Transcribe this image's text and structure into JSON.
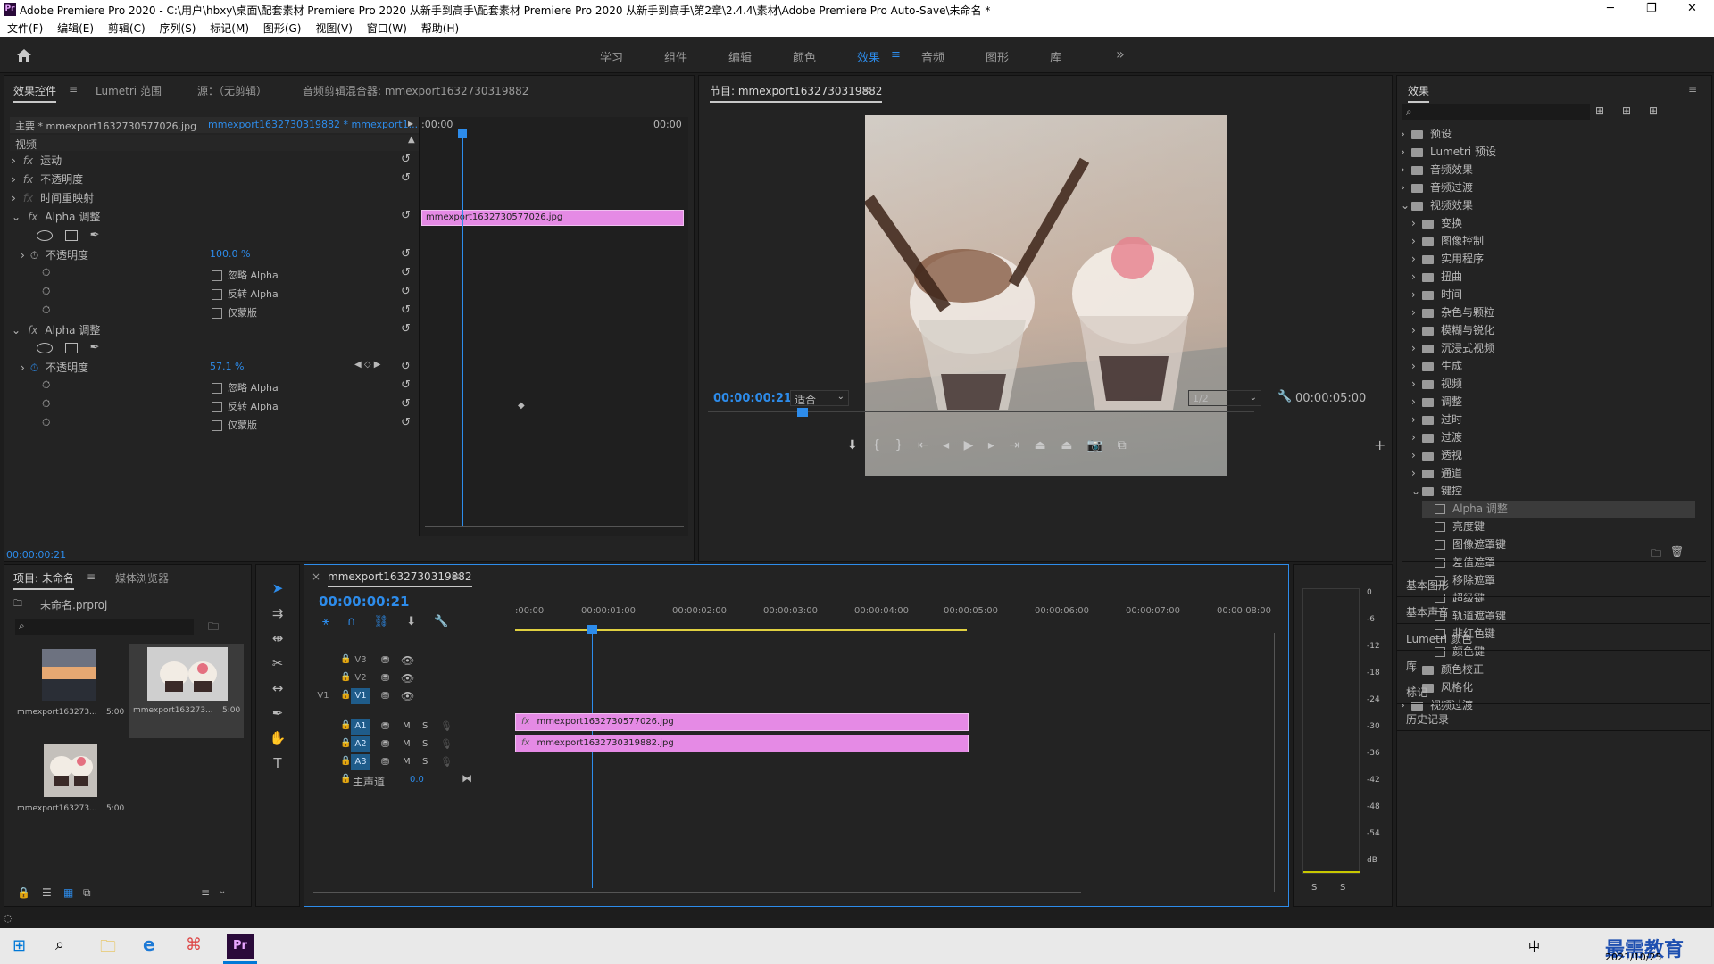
{
  "window": {
    "title": "Adobe Premiere Pro 2020 - C:\\用户\\hbxy\\桌面\\配套素材 Premiere Pro 2020 从新手到高手\\配套素材 Premiere Pro 2020 从新手到高手\\第2章\\2.4.4\\素材\\Adobe Premiere Pro Auto-Save\\未命名 *",
    "minimize": "─",
    "maximize": "❐",
    "close": "✕",
    "logo": "Pr"
  },
  "menu": [
    "文件(F)",
    "编辑(E)",
    "剪辑(C)",
    "序列(S)",
    "标记(M)",
    "图形(G)",
    "视图(V)",
    "窗口(W)",
    "帮助(H)"
  ],
  "workspaces": {
    "items": [
      "学习",
      "组件",
      "编辑",
      "颜色",
      "效果",
      "音频",
      "图形",
      "库"
    ],
    "active": "效果",
    "more": "»",
    "menu_icon": "≡"
  },
  "effect_controls": {
    "tabs": [
      "效果控件",
      "Lumetri 范围",
      "源：（无剪辑）",
      "音频剪辑混合器: mmexport1632730319882"
    ],
    "master": "主要 * mmexport1632730577026.jpg",
    "clip": "mmexport1632730319882 * mmexport1...",
    "section": "视频",
    "ruler_start": ":00:00",
    "ruler_end": "00:00",
    "clip_label": "mmexport1632730577026.jpg",
    "rows": [
      {
        "label": "运动",
        "fx": true
      },
      {
        "label": "不透明度",
        "fx": true
      },
      {
        "label": "时间重映射",
        "fx": true,
        "dim": true
      }
    ],
    "alpha1": {
      "title": "Alpha 调整",
      "opacity_label": "不透明度",
      "opacity": "100.0 %",
      "ignore": "忽略 Alpha",
      "invert": "反转 Alpha",
      "mask": "仅蒙版"
    },
    "alpha2": {
      "title": "Alpha 调整",
      "opacity_label": "不透明度",
      "opacity": "57.1 %",
      "ignore": "忽略 Alpha",
      "invert": "反转 Alpha",
      "mask": "仅蒙版"
    },
    "timecode": "00:00:00:21"
  },
  "program": {
    "title": "节目: mmexport1632730319882",
    "timecode": "00:00:00:21",
    "fit": "适合",
    "quality": "1/2",
    "duration": "00:00:05:00"
  },
  "effects_panel": {
    "title": "效果",
    "items": [
      {
        "label": "预设",
        "level": 0,
        "open": false
      },
      {
        "label": "Lumetri 预设",
        "level": 0,
        "open": false
      },
      {
        "label": "音频效果",
        "level": 0,
        "open": false
      },
      {
        "label": "音频过渡",
        "level": 0,
        "open": false
      },
      {
        "label": "视频效果",
        "level": 0,
        "open": true
      },
      {
        "label": "变换",
        "level": 1,
        "open": false
      },
      {
        "label": "图像控制",
        "level": 1,
        "open": false
      },
      {
        "label": "实用程序",
        "level": 1,
        "open": false
      },
      {
        "label": "扭曲",
        "level": 1,
        "open": false
      },
      {
        "label": "时间",
        "level": 1,
        "open": false
      },
      {
        "label": "杂色与颗粒",
        "level": 1,
        "open": false
      },
      {
        "label": "模糊与锐化",
        "level": 1,
        "open": false
      },
      {
        "label": "沉浸式视频",
        "level": 1,
        "open": false
      },
      {
        "label": "生成",
        "level": 1,
        "open": false
      },
      {
        "label": "视频",
        "level": 1,
        "open": false
      },
      {
        "label": "调整",
        "level": 1,
        "open": false
      },
      {
        "label": "过时",
        "level": 1,
        "open": false
      },
      {
        "label": "过渡",
        "level": 1,
        "open": false
      },
      {
        "label": "透视",
        "level": 1,
        "open": false
      },
      {
        "label": "通道",
        "level": 1,
        "open": false
      },
      {
        "label": "键控",
        "level": 1,
        "open": true
      },
      {
        "label": "Alpha 调整",
        "level": 2,
        "selected": true
      },
      {
        "label": "亮度键",
        "level": 2
      },
      {
        "label": "图像遮罩键",
        "level": 2
      },
      {
        "label": "差值遮罩",
        "level": 2
      },
      {
        "label": "移除遮罩",
        "level": 2
      },
      {
        "label": "超级键",
        "level": 2
      },
      {
        "label": "轨道遮罩键",
        "level": 2
      },
      {
        "label": "非红色键",
        "level": 2
      },
      {
        "label": "颜色键",
        "level": 2
      },
      {
        "label": "颜色校正",
        "level": 1,
        "open": false
      },
      {
        "label": "风格化",
        "level": 1,
        "open": false
      },
      {
        "label": "视频过渡",
        "level": 0,
        "open": false
      }
    ],
    "sections": [
      "基本图形",
      "基本声音",
      "Lumetri 颜色",
      "库",
      "标记",
      "历史记录"
    ]
  },
  "project": {
    "tabs": [
      "项目: 未命名",
      "媒体浏览器"
    ],
    "file": "未命名.prproj",
    "items": [
      {
        "name": "mmexport163273...",
        "dur": "5:00"
      },
      {
        "name": "mmexport163273...",
        "dur": "5:00"
      },
      {
        "name": "mmexport163273...",
        "dur": "5:00"
      }
    ]
  },
  "timeline": {
    "tab": "mmexport1632730319882",
    "timecode": "00:00:00:21",
    "ruler": [
      ":00:00",
      "00:00:01:00",
      "00:00:02:00",
      "00:00:03:00",
      "00:00:04:00",
      "00:00:05:00",
      "00:00:06:00",
      "00:00:07:00",
      "00:00:08:00"
    ],
    "video_tracks": [
      "V3",
      "V2",
      "V1"
    ],
    "audio_tracks": [
      "A1",
      "A2",
      "A3"
    ],
    "master": "主声道",
    "master_val": "0.0",
    "src_label": "V1",
    "clip_v2": "mmexport1632730577026.jpg",
    "clip_v1": "mmexport1632730319882.jpg",
    "m": "M",
    "s": "S"
  },
  "meter": {
    "labels": [
      "0",
      "-6",
      "-12",
      "-18",
      "-24",
      "-30",
      "-36",
      "-42",
      "-48",
      "-54",
      "dB"
    ],
    "s1": "S",
    "s2": "S"
  },
  "taskbar": {
    "time": "2021/10/25",
    "ime": "中",
    "watermark": "最需教育"
  }
}
